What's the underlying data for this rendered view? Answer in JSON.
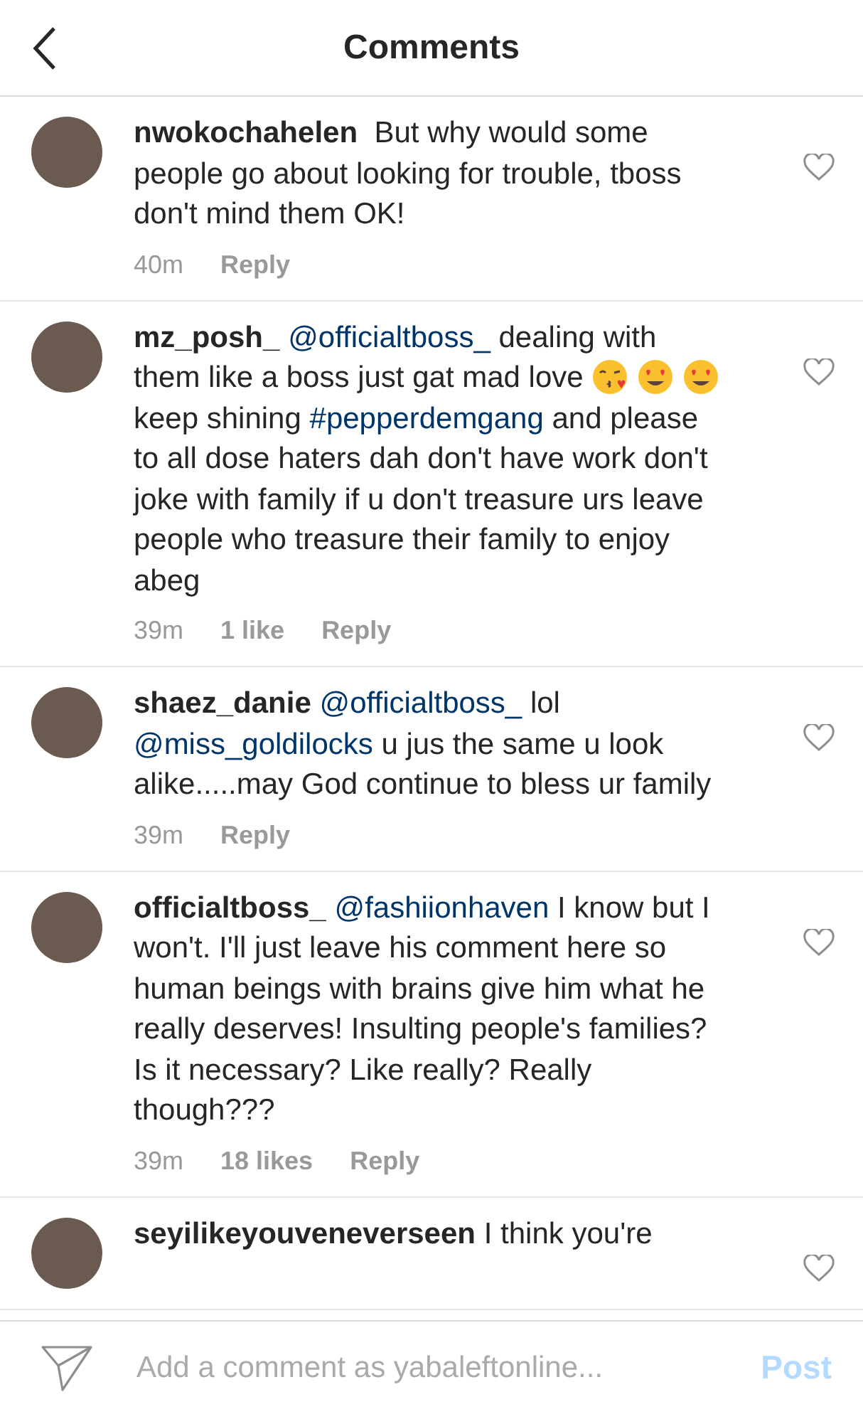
{
  "header": {
    "title": "Comments"
  },
  "comments": [
    {
      "user": "nwokochahelen",
      "body": [
        {
          "kind": "text",
          "text": " But why would some people go about looking for trouble, tboss don't mind them OK!"
        }
      ],
      "time": "40m",
      "reply": "Reply"
    },
    {
      "user": "mz_posh_",
      "body": [
        {
          "kind": "mention",
          "text": "@officialtboss_"
        },
        {
          "kind": "text",
          "text": " dealing with them like a boss just gat mad  love "
        },
        {
          "kind": "kiss"
        },
        {
          "kind": "hearteyes"
        },
        {
          "kind": "hearteyes"
        },
        {
          "kind": "text",
          "text": " keep shining "
        },
        {
          "kind": "mention",
          "text": "#pepperdemgang"
        },
        {
          "kind": "text",
          "text": " and please to all dose haters dah don't have work don't joke with family if u don't treasure urs leave people who treasure their family to enjoy abeg"
        }
      ],
      "time": "39m",
      "likes": "1 like",
      "reply": "Reply"
    },
    {
      "user": "shaez_danie",
      "body": [
        {
          "kind": "mention",
          "text": "@officialtboss_"
        },
        {
          "kind": "text",
          "text": " lol "
        },
        {
          "kind": "mention",
          "text": "@miss_goldilocks"
        },
        {
          "kind": "text",
          "text": " u jus the same u look alike.....may God continue to bless ur family"
        }
      ],
      "time": "39m",
      "reply": "Reply"
    },
    {
      "user": "officialtboss_",
      "body": [
        {
          "kind": "mention",
          "text": "@fashiionhaven"
        },
        {
          "kind": "text",
          "text": " I know but I won't. I'll just leave his comment here so human beings with brains give him what he really deserves! Insulting people's families? Is it necessary? Like really? Really though???"
        }
      ],
      "time": "39m",
      "likes": "18 likes",
      "reply": "Reply"
    },
    {
      "user": "seyilikeyouveneverseen",
      "body": [
        {
          "kind": "text",
          "text": "I think you're"
        }
      ]
    }
  ],
  "composer": {
    "placeholder": "Add a comment as yabaleftonline...",
    "post": "Post"
  }
}
